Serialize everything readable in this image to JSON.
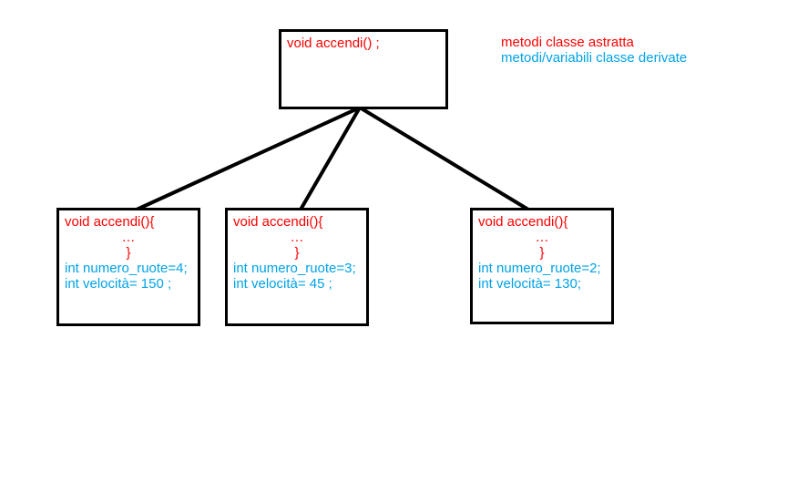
{
  "legend": {
    "abstract": "metodi classe astratta",
    "derived": "metodi/variabili classe derivate"
  },
  "parent": {
    "method_decl": "void accendi() ;"
  },
  "children": [
    {
      "method_open": "void accendi(){",
      "method_dots": "…",
      "method_close": "}",
      "var_wheels": "int numero_ruote=4;",
      "var_speed": "int velocità= 150 ;"
    },
    {
      "method_open": "void accendi(){",
      "method_dots": "…",
      "method_close": "}",
      "var_wheels": "int numero_ruote=3;",
      "var_speed": "int velocità= 45 ;"
    },
    {
      "method_open": "void accendi(){",
      "method_dots": "…",
      "method_close": "}",
      "var_wheels": "int numero_ruote=2;",
      "var_speed": "int velocità= 130;"
    }
  ]
}
